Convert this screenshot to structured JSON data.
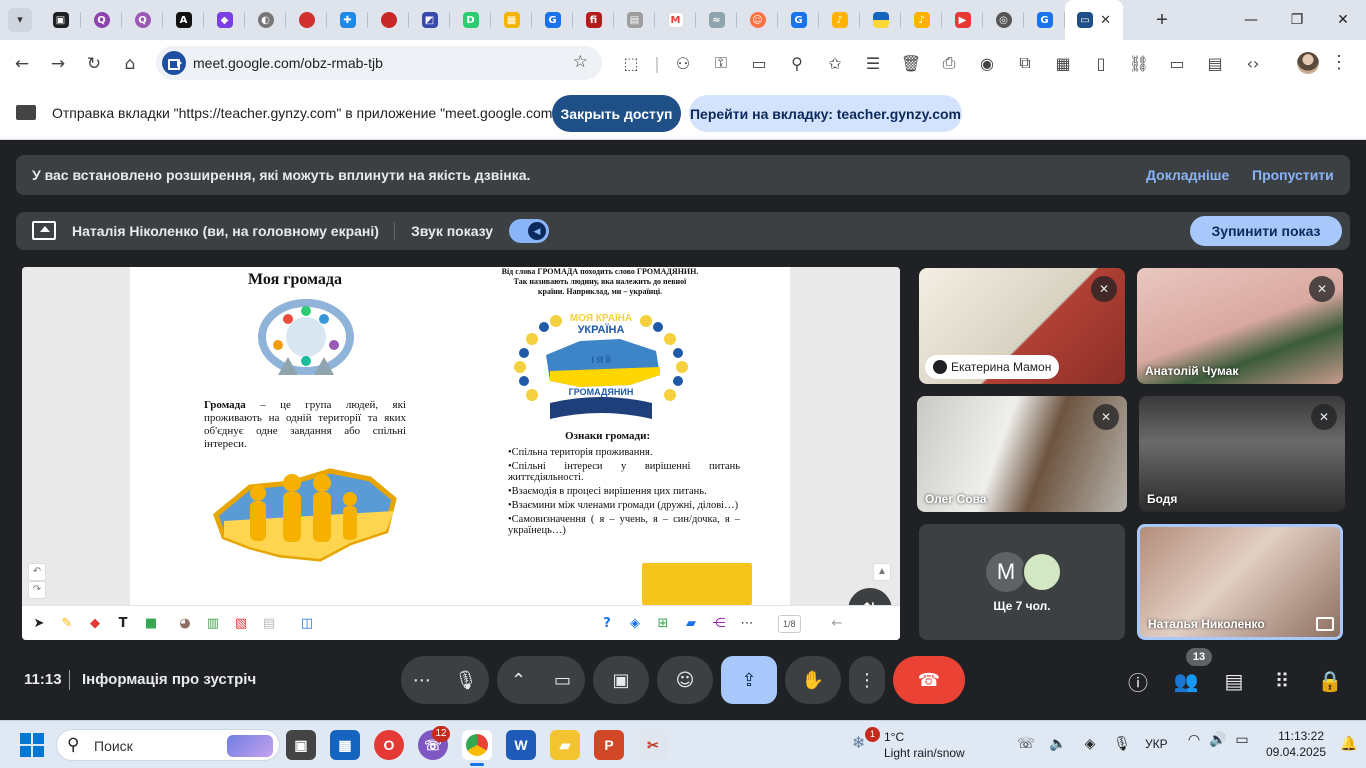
{
  "browser": {
    "url": "meet.google.com/obz-rmab-tjb",
    "tab_icons": [
      "tab-search-icon",
      "bookmark-app-icon",
      "q-app-icon",
      "q-app-icon",
      "vector-app-icon",
      "gynzy-icon",
      "globe-icon",
      "red-ball-icon",
      "puzzle-icon",
      "red-ball-icon",
      "app-icon",
      "d-app-icon",
      "classroom-icon",
      "google-docs-icon",
      "f-app-icon",
      "app-icon",
      "gmail-icon",
      "app-icon",
      "app-icon",
      "google-docs-icon",
      "bell-icon",
      "flag-icon",
      "bell-icon",
      "youtube-icon",
      "chrome-icon",
      "google-docs-icon",
      "meet-tab-icon"
    ],
    "share_notice": "Отправка вкладки \"https://teacher.gynzy.com\" в приложение \"meet.google.com\"...",
    "stop_access_label": "Закрыть доступ",
    "goto_tab_label": "Перейти на вкладку: teacher.gynzy.com"
  },
  "meet": {
    "warning": {
      "text": "У вас встановлено розширення, які можуть вплинути на якість дзвінка.",
      "more_label": "Докладніше",
      "skip_label": "Пропустити"
    },
    "presentation": {
      "presenter": "Наталія Ніколенко (ви, на головному екрані)",
      "sound_label": "Звук показу",
      "sound_on": true,
      "stop_label": "Зупинити показ"
    },
    "slide": {
      "title": "Моя громада",
      "definition_term": "Громада",
      "definition_rest": " – це група людей, які проживають на одній території та яких об'єднує одне завдання або спільні інтереси.",
      "origin_text": "Від слова ГРОМАДА походить слово ГРОМАДЯНИН. Так називають людину, яка належить до певної країни. Наприклад, ми – українці.",
      "emblem_line1": "МОЯ КРАЇНА",
      "emblem_line2": "УКРАЇНА",
      "emblem_line3": "І Я ЇЇ",
      "emblem_line4": "ГРОМАДЯНИН",
      "signs_title": "Ознаки громади:",
      "signs": [
        "•Спільна територія проживання.",
        "•Спільні інтереси у вирішенні питань життєдіяльності.",
        "•Взаємодія в процесі вирішення цих питань.",
        "•Взаємини між членами громади (дружні, ділові…)",
        "•Самовизначення ( я – учень, я – син/дочка, я – українець…)"
      ],
      "page_indicator": "1/8"
    },
    "participants": [
      {
        "name": "Екатерина Мамон",
        "muted": true
      },
      {
        "name": "Анатолій Чумак",
        "muted": true
      },
      {
        "name": "Олег Сова",
        "muted": true
      },
      {
        "name": "Бодя",
        "muted": true
      },
      {
        "name": "Наталья Николенко",
        "muted": false
      }
    ],
    "more": {
      "avatar_letter": "M",
      "label": "Ще 7 чол."
    },
    "time": "11:13",
    "meeting_info": "Інформація про зустріч",
    "people_count": "13",
    "colors": {
      "leave": "#ea4335",
      "present": "#a8c7fa",
      "link": "#8ab4f8"
    }
  },
  "taskbar": {
    "search_placeholder": "Поиск",
    "chat_badge": "12",
    "weather_badge": "1",
    "temperature": "1°C",
    "weather": "Light rain/snow",
    "language": "УКР",
    "time": "11:13:22",
    "date": "09.04.2025"
  }
}
